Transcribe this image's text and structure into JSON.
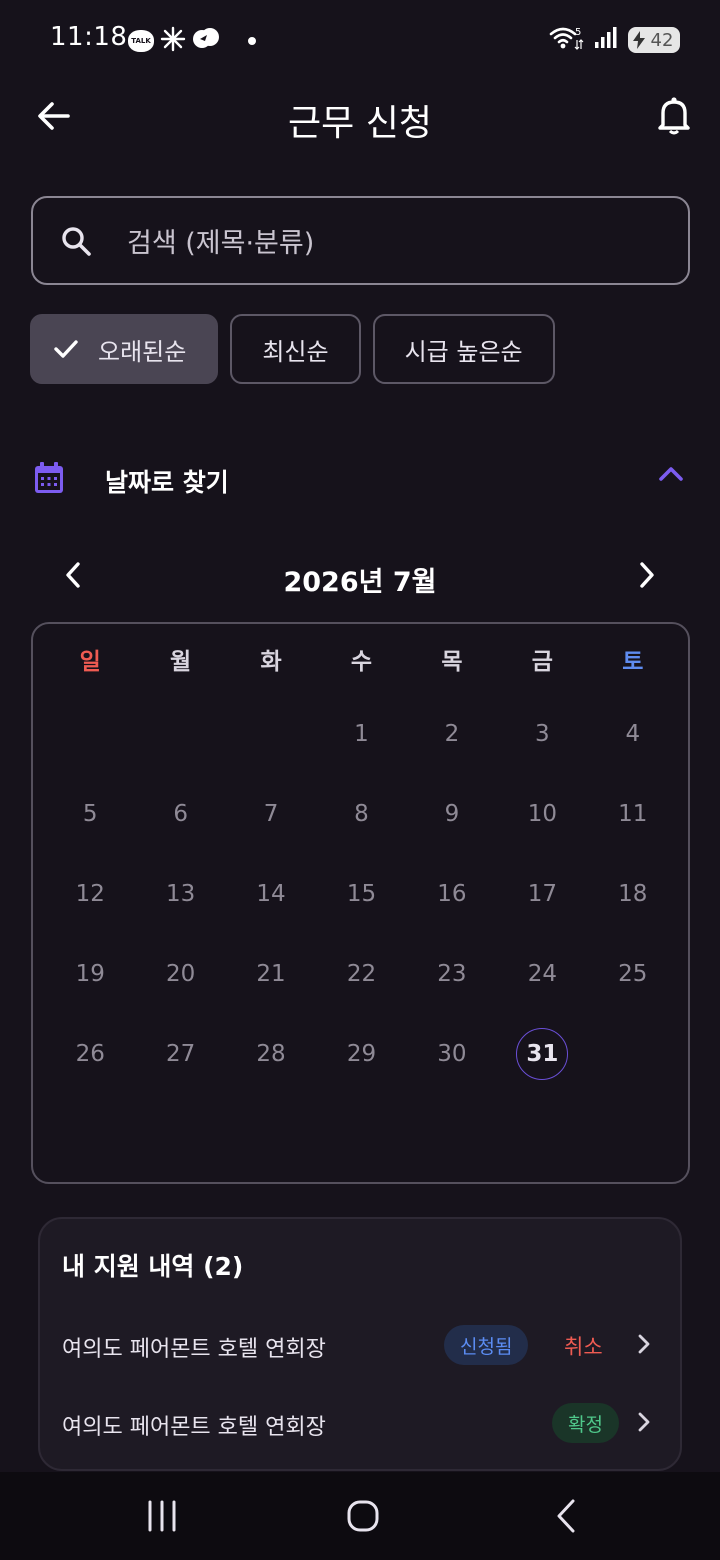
{
  "status_bar": {
    "time": "11:18",
    "talk_icon_label": "TALK",
    "wifi_label": "5",
    "battery_level": "42"
  },
  "header": {
    "title": "근무 신청"
  },
  "search": {
    "placeholder": "검색 (제목·분류)"
  },
  "sort_chips": [
    {
      "label": "오래된순",
      "selected": true
    },
    {
      "label": "최신순",
      "selected": false
    },
    {
      "label": "시급 높은순",
      "selected": false
    }
  ],
  "date_filter": {
    "title": "날짜로 찾기",
    "month_label": "2026년 7월",
    "weekdays": [
      "일",
      "월",
      "화",
      "수",
      "목",
      "금",
      "토"
    ],
    "leading_blank_days": 3,
    "days_in_month": 31,
    "today": 31
  },
  "applications": {
    "title": "내 지원 내역 (2)",
    "items": [
      {
        "name": "여의도 페어몬트 호텔 연회장",
        "status": "신청됨",
        "action": "취소"
      },
      {
        "name": "여의도 페어몬트 호텔 연회장",
        "status": "확정"
      }
    ]
  },
  "colors": {
    "background": "#16121b",
    "accent_purple": "#7c5cf0",
    "sunday_red": "#ef5b52",
    "saturday_blue": "#5f8cf0",
    "applied_blue": "#5b8cf2",
    "confirmed_green": "#4fc78a"
  }
}
